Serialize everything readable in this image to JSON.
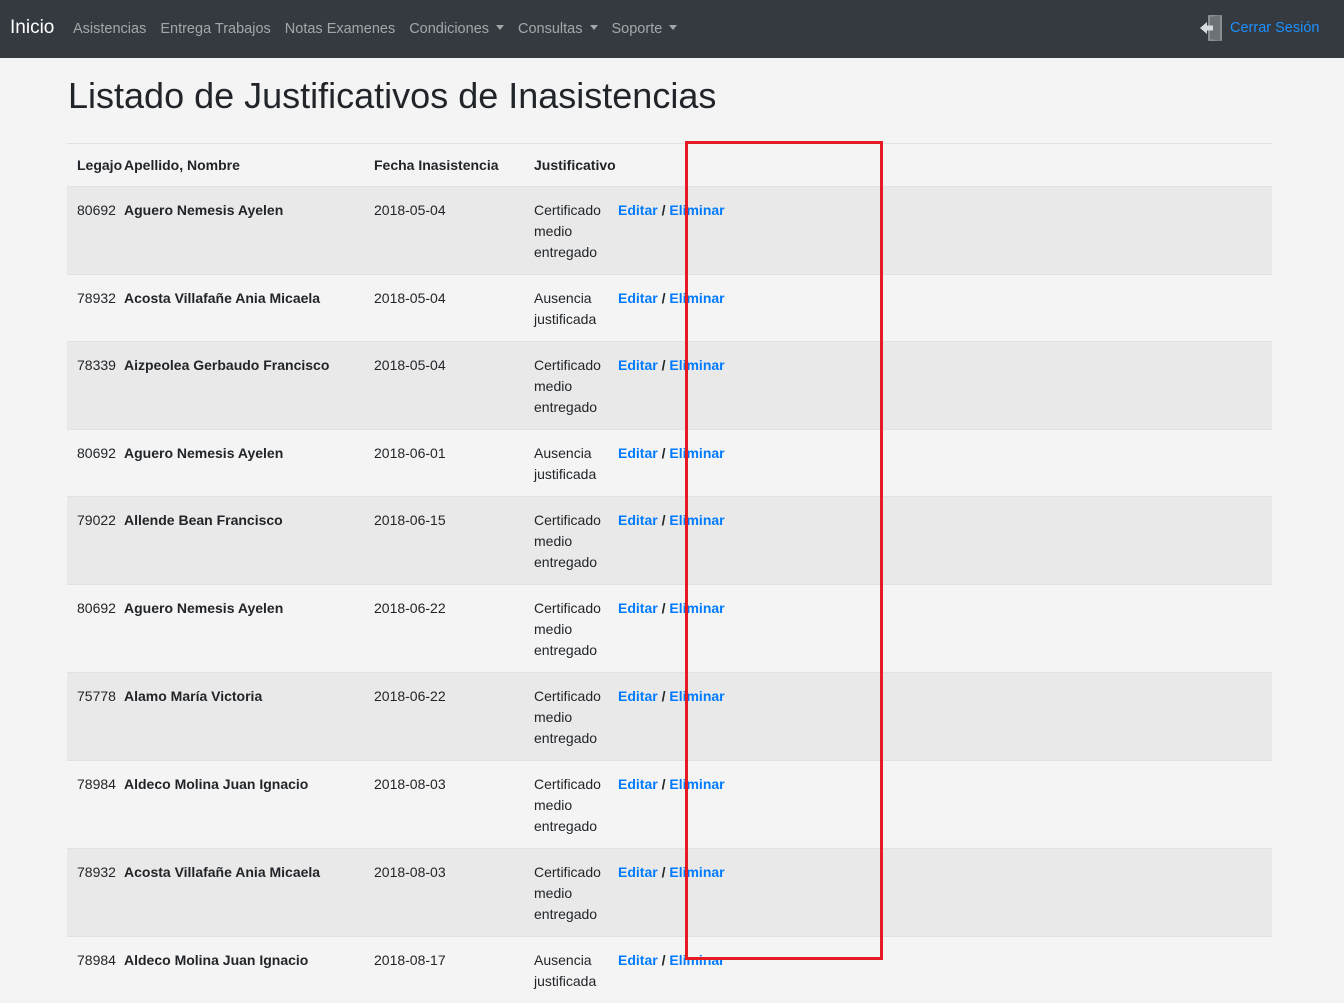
{
  "navbar": {
    "brand": "Inicio",
    "links": [
      {
        "label": "Asistencias",
        "dropdown": false
      },
      {
        "label": "Entrega Trabajos",
        "dropdown": false
      },
      {
        "label": "Notas Examenes",
        "dropdown": false
      },
      {
        "label": "Condiciones",
        "dropdown": true
      },
      {
        "label": "Consultas",
        "dropdown": true
      },
      {
        "label": "Soporte",
        "dropdown": true
      }
    ],
    "logout_label": "Cerrar Sesión",
    "logout_icon": "exit-door-icon"
  },
  "page": {
    "title": "Listado de Justificativos de Inasistencias"
  },
  "table": {
    "headers": {
      "legajo": "Legajo",
      "nombre": "Apellido, Nombre",
      "fecha": "Fecha Inasistencia",
      "justificativo": "Justificativo",
      "acciones": ""
    },
    "actions": {
      "edit": "Editar",
      "separator": "/",
      "delete": "Eliminar"
    },
    "rows": [
      {
        "legajo": "80692",
        "nombre": "Aguero Nemesis Ayelen",
        "fecha": "2018-05-04",
        "justificativo": "Certificado medio entregado"
      },
      {
        "legajo": "78932",
        "nombre": "Acosta Villafañe Ania Micaela",
        "fecha": "2018-05-04",
        "justificativo": "Ausencia justificada"
      },
      {
        "legajo": "78339",
        "nombre": "Aizpeolea Gerbaudo Francisco",
        "fecha": "2018-05-04",
        "justificativo": "Certificado medio entregado"
      },
      {
        "legajo": "80692",
        "nombre": "Aguero Nemesis Ayelen",
        "fecha": "2018-06-01",
        "justificativo": "Ausencia justificada"
      },
      {
        "legajo": "79022",
        "nombre": "Allende Bean Francisco",
        "fecha": "2018-06-15",
        "justificativo": "Certificado medio entregado"
      },
      {
        "legajo": "80692",
        "nombre": "Aguero Nemesis Ayelen",
        "fecha": "2018-06-22",
        "justificativo": "Certificado medio entregado"
      },
      {
        "legajo": "75778",
        "nombre": "Alamo María Victoria",
        "fecha": "2018-06-22",
        "justificativo": "Certificado medio entregado"
      },
      {
        "legajo": "78984",
        "nombre": "Aldeco Molina Juan Ignacio",
        "fecha": "2018-08-03",
        "justificativo": "Certificado medio entregado"
      },
      {
        "legajo": "78932",
        "nombre": "Acosta Villafañe Ania Micaela",
        "fecha": "2018-08-03",
        "justificativo": "Certificado medio entregado"
      },
      {
        "legajo": "78984",
        "nombre": "Aldeco Molina Juan Ignacio",
        "fecha": "2018-08-17",
        "justificativo": "Ausencia justificada"
      }
    ]
  },
  "colors": {
    "navbar_bg": "#343a40",
    "link": "#007bff",
    "highlight": "#e51c23"
  }
}
